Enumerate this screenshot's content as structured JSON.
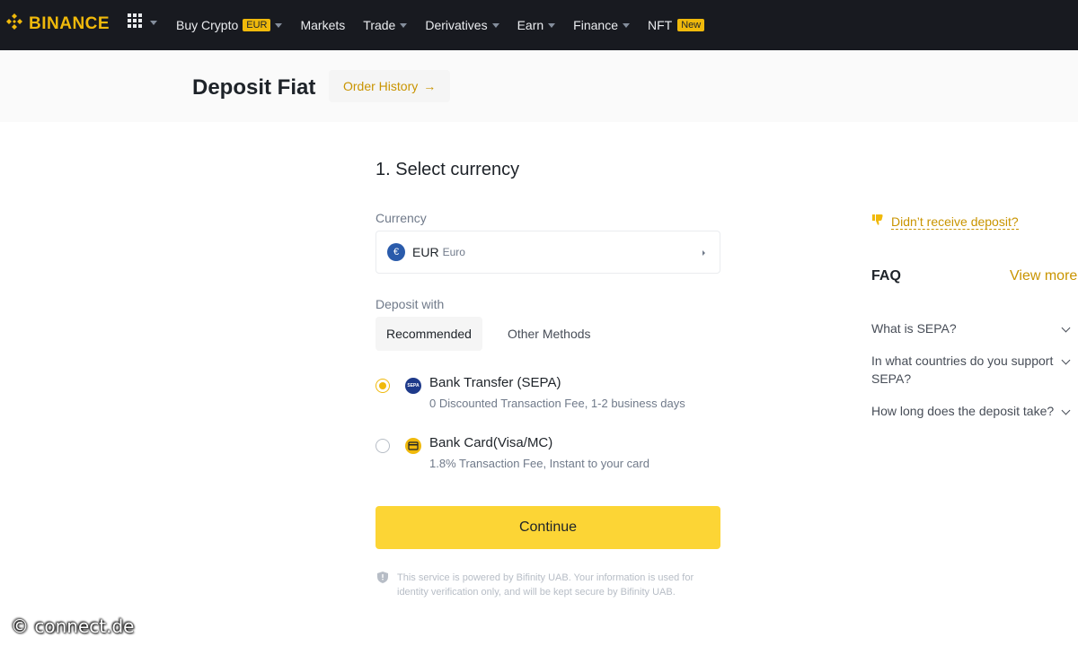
{
  "nav": {
    "logo_text": "BINANCE",
    "items": [
      {
        "label": "Buy Crypto",
        "badge": "EUR",
        "has_caret": true
      },
      {
        "label": "Markets",
        "has_caret": false
      },
      {
        "label": "Trade",
        "has_caret": true
      },
      {
        "label": "Derivatives",
        "has_caret": true
      },
      {
        "label": "Earn",
        "has_caret": true
      },
      {
        "label": "Finance",
        "has_caret": true
      },
      {
        "label": "NFT",
        "badge": "New",
        "has_caret": false
      }
    ]
  },
  "header": {
    "title": "Deposit Fiat",
    "order_history_label": "Order History",
    "order_history_arrow": "→"
  },
  "form": {
    "step_title": "1. Select currency",
    "currency_label": "Currency",
    "currency_symbol": "€",
    "currency_code": "EUR",
    "currency_name": "Euro",
    "deposit_with_label": "Deposit with",
    "tabs": [
      "Recommended",
      "Other Methods"
    ],
    "options": [
      {
        "title": "Bank Transfer (SEPA)",
        "desc": "0 Discounted Transaction Fee, 1-2 business days",
        "icon_text": "SEPA",
        "selected": true
      },
      {
        "title": "Bank Card(Visa/MC)",
        "desc": "1.8% Transaction Fee, Instant to your card",
        "selected": false
      }
    ],
    "continue_label": "Continue",
    "disclaimer": "This service is powered by Bifinity UAB. Your information is used for identity verification only, and will be kept secure by Bifinity UAB."
  },
  "sidebar": {
    "didnt_receive": "Didn’t receive deposit?",
    "faq_title": "FAQ",
    "view_more": "View more",
    "faq_items": [
      "What is SEPA?",
      "In what countries do you support SEPA?",
      "How long does the deposit take?"
    ]
  },
  "watermark": "© connect.de",
  "colors": {
    "brand": "#f0b90b",
    "button": "#fcd535",
    "nav_bg": "#181a20",
    "link": "#c99400"
  },
  "icons": [
    "binance-logo-icon",
    "apps-grid-icon",
    "euro-coin-icon",
    "sepa-icon",
    "bank-card-icon",
    "shield-icon",
    "thumb-down-icon",
    "chevron-down-icon"
  ]
}
